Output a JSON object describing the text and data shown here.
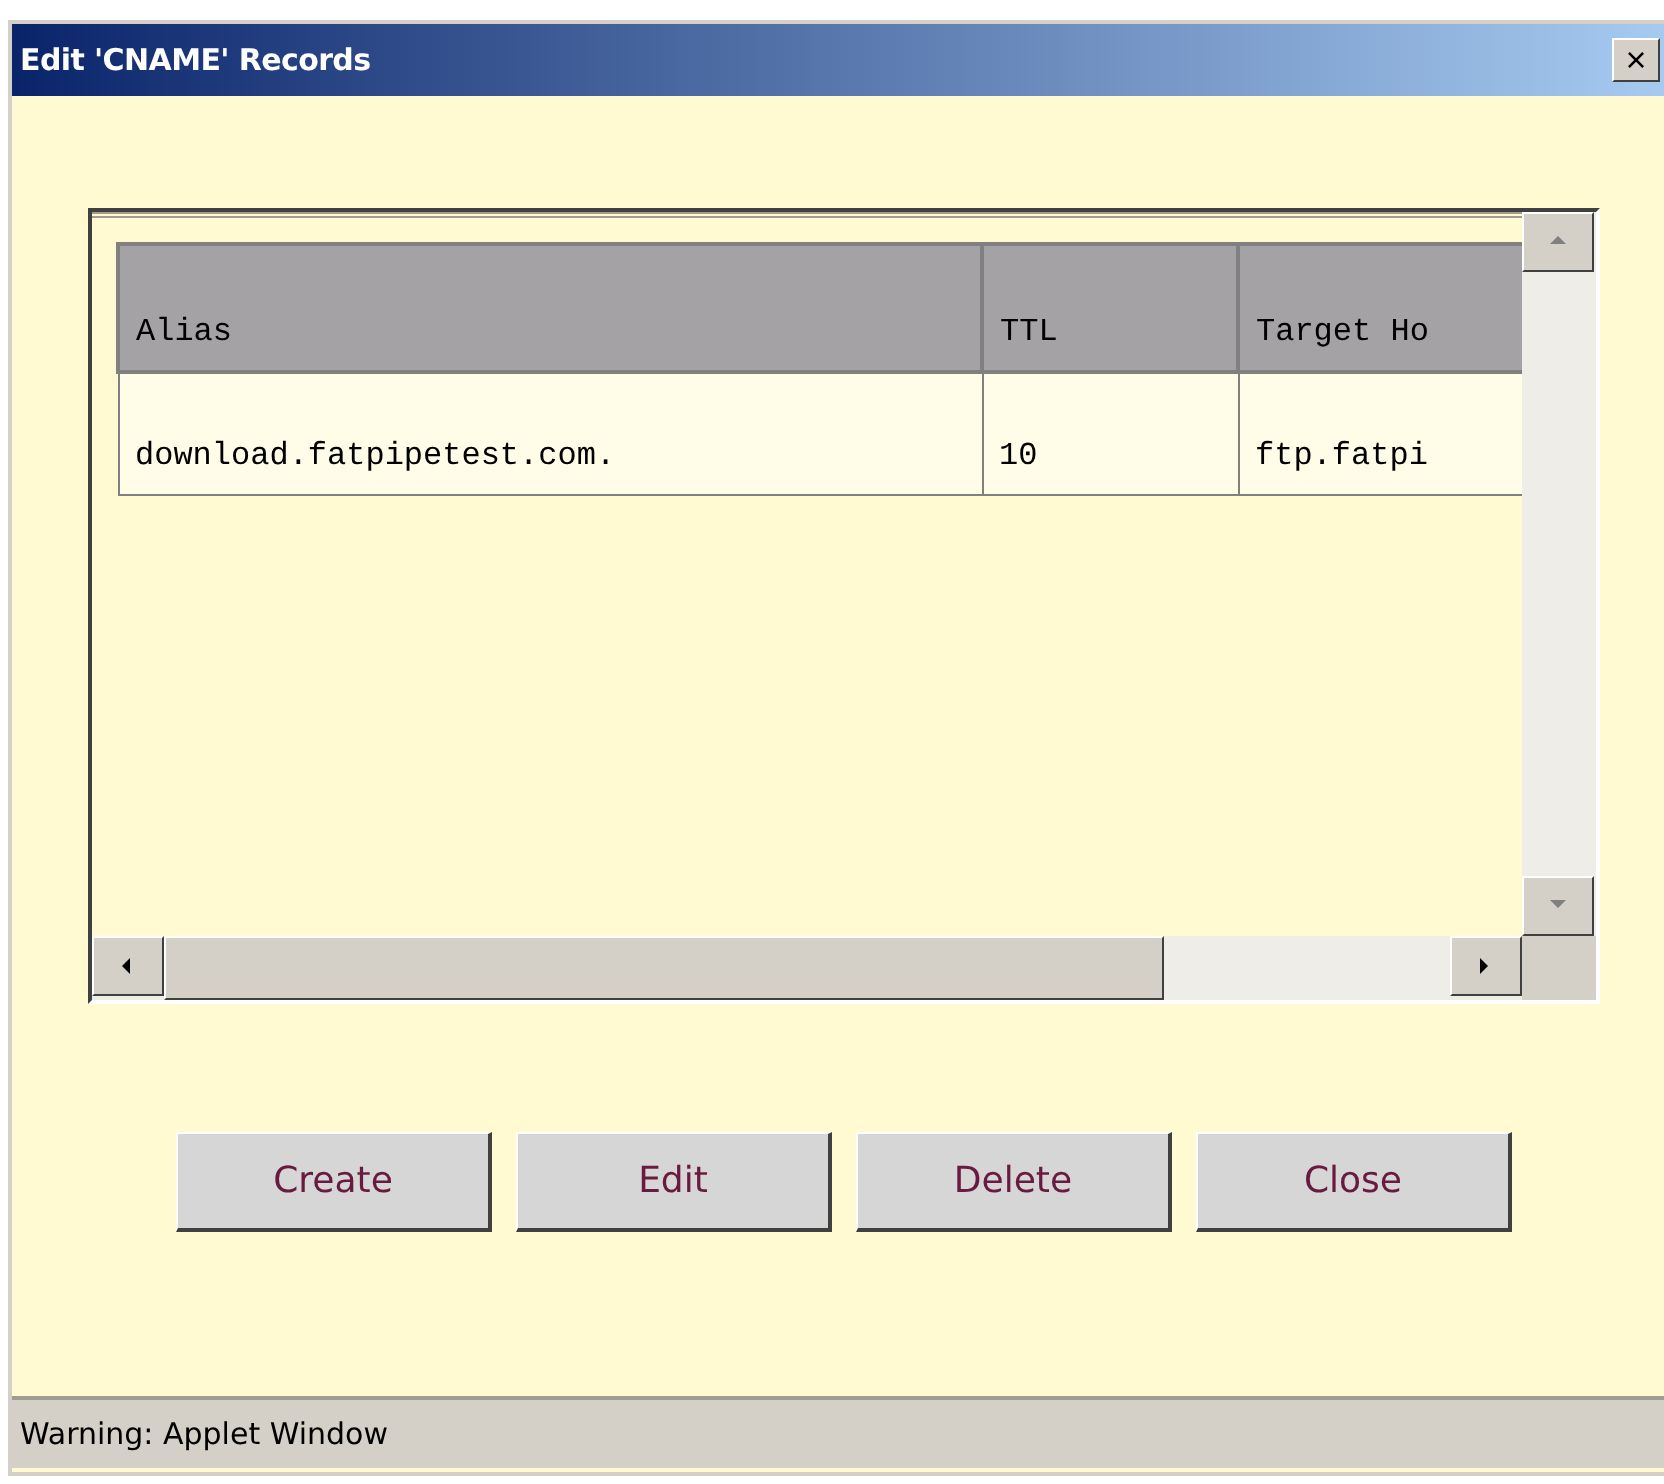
{
  "window": {
    "title": "Edit 'CNAME' Records",
    "close_glyph": "×"
  },
  "table": {
    "columns": [
      "Alias",
      "TTL",
      "Target Ho"
    ],
    "rows": [
      [
        "download.fatpipetest.com.",
        "10",
        "ftp.fatpi"
      ]
    ]
  },
  "buttons": [
    "Create",
    "Edit",
    "Delete",
    "Close"
  ],
  "status_bar": "Warning: Applet Window"
}
